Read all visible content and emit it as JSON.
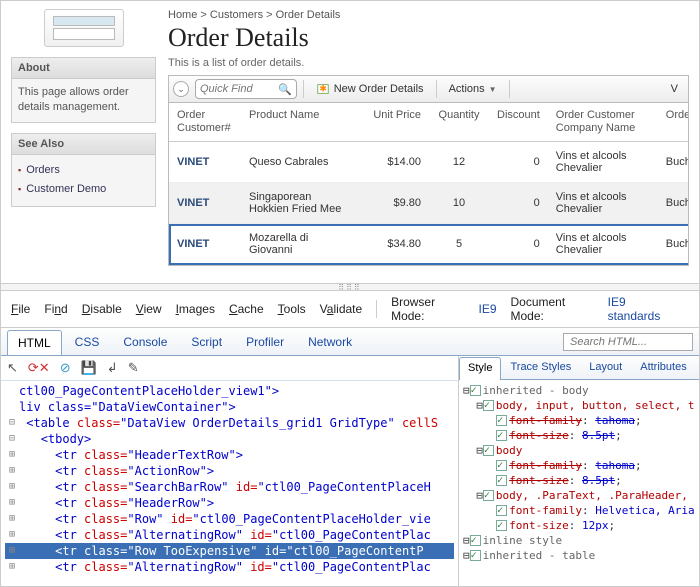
{
  "breadcrumb": {
    "a": "Home",
    "b": "Customers",
    "c": "Order Details"
  },
  "page": {
    "title": "Order Details",
    "subtitle": "This is a list of order details."
  },
  "sidebar": {
    "about": {
      "title": "About",
      "body": "This page allows order details management."
    },
    "seealso": {
      "title": "See Also",
      "items": [
        "Orders",
        "Customer Demo"
      ]
    }
  },
  "toolbar": {
    "quickfind_placeholder": "Quick Find",
    "new_label": "New Order Details",
    "actions_label": "Actions",
    "view_label": "V"
  },
  "grid": {
    "headers": {
      "c0": "Order Customer#",
      "c1": "Product Name",
      "c2": "Unit Price",
      "c3": "Quantity",
      "c4": "Discount",
      "c5": "Order Customer Company Name",
      "c6": "Order Employee Last Nar"
    },
    "rows": [
      {
        "cust": "VINET",
        "prod": "Queso Cabrales",
        "price": "$14.00",
        "qty": "12",
        "disc": "0",
        "comp": "Vins et alcools Chevalier",
        "emp": "Buchana"
      },
      {
        "cust": "VINET",
        "prod": "Singaporean Hokkien Fried Mee",
        "price": "$9.80",
        "qty": "10",
        "disc": "0",
        "comp": "Vins et alcools Chevalier",
        "emp": "Buchana"
      },
      {
        "cust": "VINET",
        "prod": "Mozarella di Giovanni",
        "price": "$34.80",
        "qty": "5",
        "disc": "0",
        "comp": "Vins et alcools Chevalier",
        "emp": "Buchana"
      }
    ]
  },
  "devtools": {
    "menu": [
      "File",
      "Find",
      "Disable",
      "View",
      "Images",
      "Cache",
      "Tools",
      "Validate"
    ],
    "browser_mode_label": "Browser Mode:",
    "browser_mode": "IE9",
    "doc_mode_label": "Document Mode:",
    "doc_mode": "IE9 standards",
    "tabs": [
      "HTML",
      "CSS",
      "Console",
      "Script",
      "Profiler",
      "Network"
    ],
    "search_placeholder": "Search HTML...",
    "code": {
      "l0": {
        "pre": "",
        "t1": "ctl00_PageContentPlaceHolder_view1",
        "post": "\">"
      },
      "l1": {
        "a": "liv class=",
        "v": "\"DataViewContainer\"",
        "p": ">"
      },
      "l2": {
        "a": "<table ",
        "b": "class=",
        "v": "\"DataView OrderDetails_grid1 GridType\"",
        "c": " cellS"
      },
      "l3": "<tbody>",
      "l4": {
        "a": "<tr ",
        "b": "class=",
        "v": "\"HeaderTextRow\"",
        "p": ">"
      },
      "l5": {
        "a": "<tr ",
        "b": "class=",
        "v": "\"ActionRow\"",
        "p": ">"
      },
      "l6": {
        "a": "<tr ",
        "b": "class=",
        "v": "\"SearchBarRow\"",
        "c": " id=",
        "v2": "\"ctl00_PageContentPlaceH",
        "p": ""
      },
      "l7": {
        "a": "<tr ",
        "b": "class=",
        "v": "\"HeaderRow\"",
        "p": ">"
      },
      "l8": {
        "a": "<tr ",
        "b": "class=",
        "v": "\"Row\"",
        "c": " id=",
        "v2": "\"ctl00_PageContentPlaceHolder_vie",
        "p": ""
      },
      "l9": {
        "a": "<tr ",
        "b": "class=",
        "v": "\"AlternatingRow\"",
        "c": " id=",
        "v2": "\"ctl00_PageContentPlac",
        "p": ""
      },
      "l10": {
        "a": "<tr ",
        "b": "class=",
        "v": "\"Row  TooExpensive\"",
        "c": " id=",
        "v2": "\"ctl00_PageContentP",
        "p": ""
      },
      "l11": {
        "a": "<tr ",
        "b": "class=",
        "v": "\"AlternatingRow\"",
        "c": " id=",
        "v2": "\"ctl00_PageContentPlac",
        "p": ""
      }
    },
    "right_tabs": [
      "Style",
      "Trace Styles",
      "Layout",
      "Attributes"
    ],
    "styles": {
      "h0": "inherited - body",
      "s0": "body, input, button, select, t",
      "p0a": "font-family",
      "p0av": "tahoma",
      "p0b": "font-size",
      "p0bv": "8.5pt",
      "s1": "body",
      "p1a": "font-family",
      "p1av": "tahoma",
      "p1b": "font-size",
      "p1bv": "8.5pt",
      "s2": "body, .ParaText, .ParaHeader, ",
      "p2a": "font-family",
      "p2av": "Helvetica, Aria",
      "p2b": "font-size",
      "p2bv": "12px",
      "h1": "inline style",
      "h2": "inherited - table"
    }
  }
}
